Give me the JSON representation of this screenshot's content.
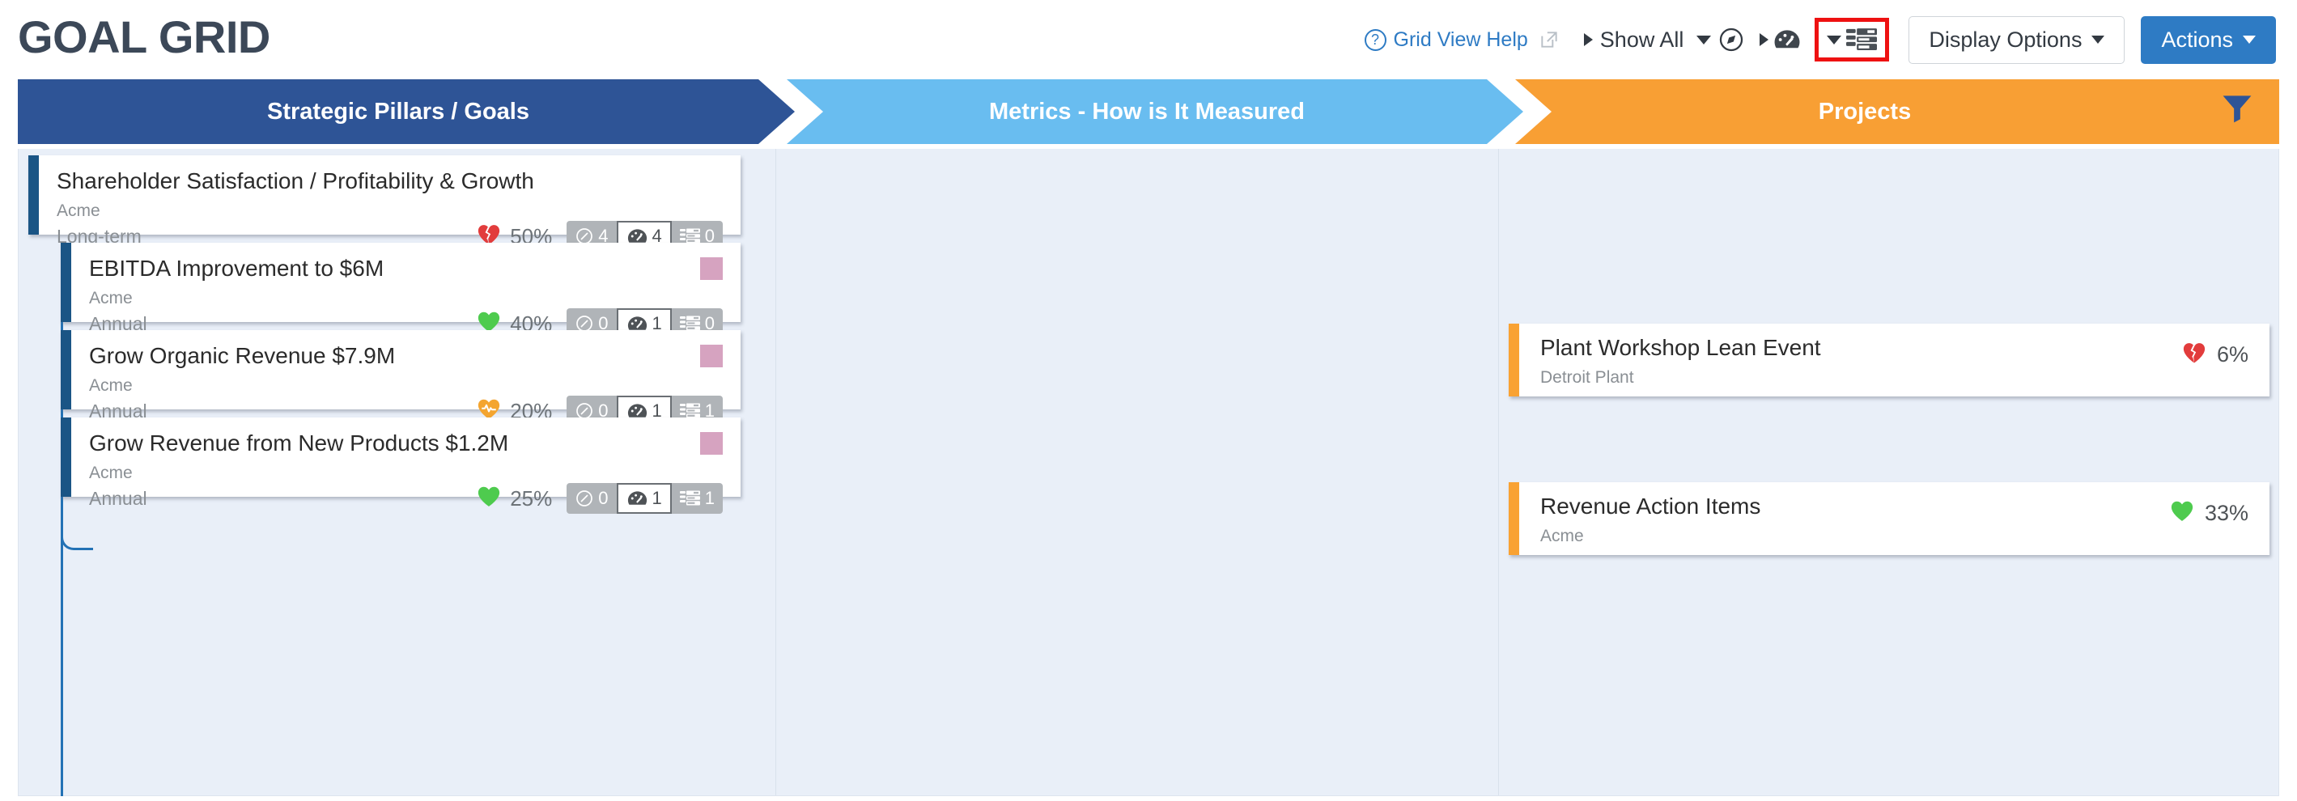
{
  "header": {
    "title": "GOAL GRID",
    "help_label": "Grid View Help",
    "help_icon": "question-circle-icon",
    "external_link_icon": "external-link-icon",
    "show_all_label": "Show All",
    "compass_icon": "compass-icon",
    "gauge_icon": "gauge-icon",
    "list_icon": "list-view-icon",
    "display_options_label": "Display Options",
    "actions_label": "Actions",
    "accent_color": "#2e7bc4",
    "highlight_color": "#ee1111"
  },
  "columns": [
    {
      "label": "Strategic Pillars / Goals",
      "color": "#2e5496"
    },
    {
      "label": "Metrics - How is It Measured",
      "color": "#69bdf0"
    },
    {
      "label": "Projects",
      "color": "#f89f34",
      "filter_icon": "filter-icon"
    }
  ],
  "goals": [
    {
      "title": "Shareholder Satisfaction / Profitability & Growth",
      "owner": "Acme",
      "term": "Long-term",
      "health": "50%",
      "health_icon": "broken-heart-icon",
      "health_color": "#e23c3c",
      "chip_color": "#d6a3c0",
      "badges": [
        {
          "icon": "compass-icon",
          "count": "4",
          "selected": false
        },
        {
          "icon": "gauge-icon",
          "count": "4",
          "selected": true
        },
        {
          "icon": "project-list-icon",
          "count": "0",
          "selected": false
        }
      ]
    },
    {
      "title": "EBITDA Improvement to $6M",
      "owner": "Acme",
      "term": "Annual",
      "health": "40%",
      "health_icon": "heart-icon",
      "health_color": "#4ecb4e",
      "chip_color": "#d6a3c0",
      "badges": [
        {
          "icon": "compass-icon",
          "count": "0",
          "selected": false
        },
        {
          "icon": "gauge-icon",
          "count": "1",
          "selected": true
        },
        {
          "icon": "project-list-icon",
          "count": "0",
          "selected": false
        }
      ]
    },
    {
      "title": "Grow Organic Revenue $7.9M",
      "owner": "Acme",
      "term": "Annual",
      "health": "20%",
      "health_icon": "heartbeat-icon",
      "health_color": "#f4a530",
      "chip_color": "#d6a3c0",
      "badges": [
        {
          "icon": "compass-icon",
          "count": "0",
          "selected": false
        },
        {
          "icon": "gauge-icon",
          "count": "1",
          "selected": true
        },
        {
          "icon": "project-list-icon",
          "count": "1",
          "selected": false
        }
      ]
    },
    {
      "title": "Grow Revenue from New Products $1.2M",
      "owner": "Acme",
      "term": "Annual",
      "health": "25%",
      "health_icon": "heart-icon",
      "health_color": "#4ecb4e",
      "chip_color": "#d6a3c0",
      "badges": [
        {
          "icon": "compass-icon",
          "count": "0",
          "selected": false
        },
        {
          "icon": "gauge-icon",
          "count": "1",
          "selected": true
        },
        {
          "icon": "project-list-icon",
          "count": "1",
          "selected": false
        }
      ]
    }
  ],
  "projects": [
    {
      "title": "Plant Workshop Lean Event",
      "owner": "Detroit Plant",
      "health": "6%",
      "health_icon": "broken-heart-icon",
      "health_color": "#e23c3c"
    },
    {
      "title": "Revenue Action Items",
      "owner": "Acme",
      "health": "33%",
      "health_icon": "heart-icon",
      "health_color": "#4ecb4e"
    }
  ]
}
